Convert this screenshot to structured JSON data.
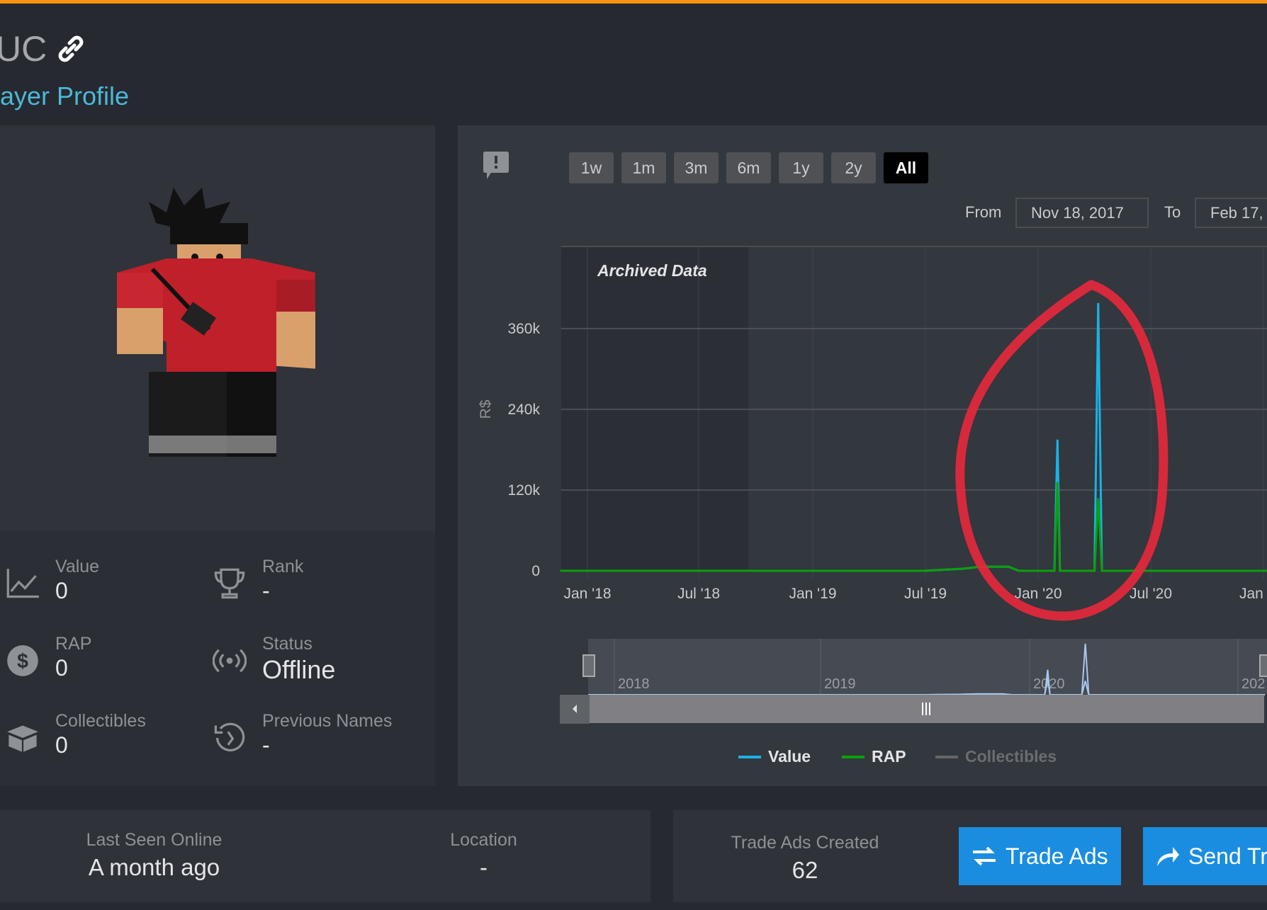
{
  "header": {
    "title": "UC",
    "subtitle": "layer Profile"
  },
  "colors": {
    "accent_top": "#f7930e",
    "link": "#4cb8d8",
    "value": "#19b2e6",
    "rap": "#0aa10a",
    "collectibles": "#666666",
    "annotation": "#e8283c",
    "button": "#1a8de0"
  },
  "stats": [
    {
      "label": "Value",
      "value": "0",
      "icon": "chart-line-icon"
    },
    {
      "label": "Rank",
      "value": "-",
      "icon": "trophy-icon"
    },
    {
      "label": "RAP",
      "value": "0",
      "icon": "dollar-circle-icon"
    },
    {
      "label": "Status",
      "value": "Offline",
      "icon": "broadcast-icon"
    },
    {
      "label": "Collectibles",
      "value": "0",
      "icon": "box-icon"
    },
    {
      "label": "Previous Names",
      "value": "-",
      "icon": "history-icon"
    }
  ],
  "range_buttons": [
    "1w",
    "1m",
    "3m",
    "6m",
    "1y",
    "2y",
    "All"
  ],
  "range_selected": "All",
  "date_range": {
    "from_label": "From",
    "from": "Nov 18, 2017",
    "to_label": "To",
    "to": "Feb 17,"
  },
  "chart_data": {
    "type": "line",
    "archived_label": "Archived Data",
    "ylabel": "R$",
    "yticks": [
      "0",
      "120k",
      "240k",
      "360k"
    ],
    "xticks": [
      "Jan '18",
      "Jul '18",
      "Jan '19",
      "Jul '19",
      "Jan '20",
      "Jul '20",
      "Jan"
    ],
    "navigator_ticks": [
      "2018",
      "2019",
      "2020",
      "202"
    ],
    "grid": true,
    "legend_placement": "bottom",
    "series": [
      {
        "name": "Value",
        "points": [
          [
            "2017-11-18",
            0
          ],
          [
            "2019-07-01",
            0
          ],
          [
            "2019-09-01",
            3000
          ],
          [
            "2019-10-01",
            6000
          ],
          [
            "2019-11-15",
            6000
          ],
          [
            "2019-12-01",
            0
          ],
          [
            "2020-01-28",
            0
          ],
          [
            "2020-02-02",
            195000
          ],
          [
            "2020-02-06",
            0
          ],
          [
            "2020-04-02",
            0
          ],
          [
            "2020-04-08",
            398000
          ],
          [
            "2020-04-14",
            0
          ],
          [
            "2021-02-17",
            0
          ]
        ]
      },
      {
        "name": "RAP",
        "points": [
          [
            "2017-11-18",
            0
          ],
          [
            "2019-07-01",
            0
          ],
          [
            "2019-09-01",
            3000
          ],
          [
            "2019-10-01",
            6000
          ],
          [
            "2019-11-15",
            6000
          ],
          [
            "2019-12-01",
            0
          ],
          [
            "2020-01-28",
            0
          ],
          [
            "2020-02-02",
            132000
          ],
          [
            "2020-02-06",
            0
          ],
          [
            "2020-04-02",
            0
          ],
          [
            "2020-04-08",
            108000
          ],
          [
            "2020-04-14",
            0
          ],
          [
            "2021-02-17",
            0
          ]
        ]
      },
      {
        "name": "Collectibles",
        "points": []
      }
    ]
  },
  "bottom": {
    "last_seen_label": "Last Seen Online",
    "last_seen": "A month ago",
    "location_label": "Location",
    "location": "-",
    "trade_ads_label": "Trade Ads Created",
    "trade_ads": "62",
    "trade_ads_button": "Trade Ads",
    "send_button": "Send Tr"
  }
}
